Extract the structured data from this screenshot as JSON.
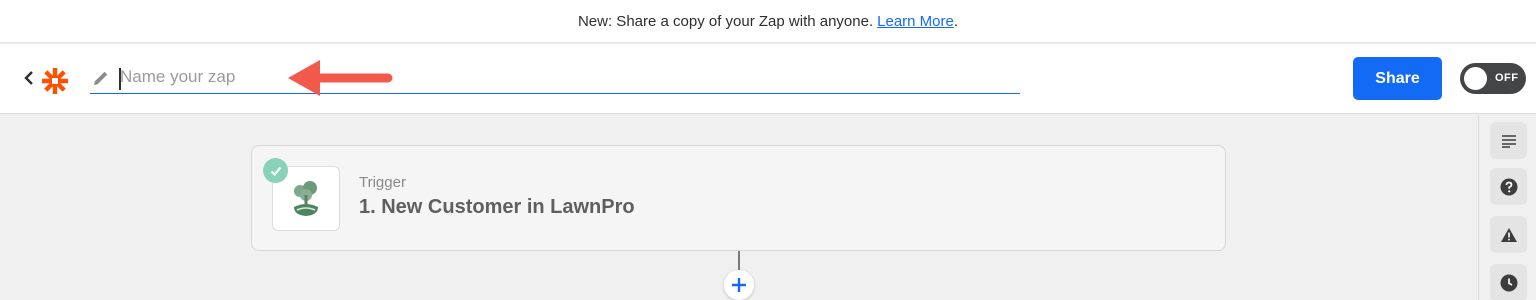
{
  "banner": {
    "text": "New: Share a copy of your Zap with anyone.",
    "link_text": "Learn More",
    "suffix": "."
  },
  "header": {
    "back_icon": "chevron-left-icon",
    "logo_icon": "zapier-asterisk-icon",
    "edit_icon": "pencil-icon",
    "name_input": {
      "value": "",
      "placeholder": "Name your zap"
    },
    "share_label": "Share",
    "toggle": {
      "state_label": "OFF"
    }
  },
  "step": {
    "kind": "Trigger",
    "title": "1. New Customer in LawnPro",
    "status": "complete",
    "app_icon": "lawnpro-tree-icon"
  },
  "sidebar": {
    "items": [
      {
        "icon": "details-lines-icon"
      },
      {
        "icon": "help-question-icon"
      },
      {
        "icon": "warning-triangle-icon"
      },
      {
        "icon": "history-clock-icon"
      }
    ]
  },
  "colors": {
    "accent": "#136bf5",
    "logo": "#ff4f00",
    "annotation_arrow": "#f2594b",
    "check": "#87d2b8"
  }
}
